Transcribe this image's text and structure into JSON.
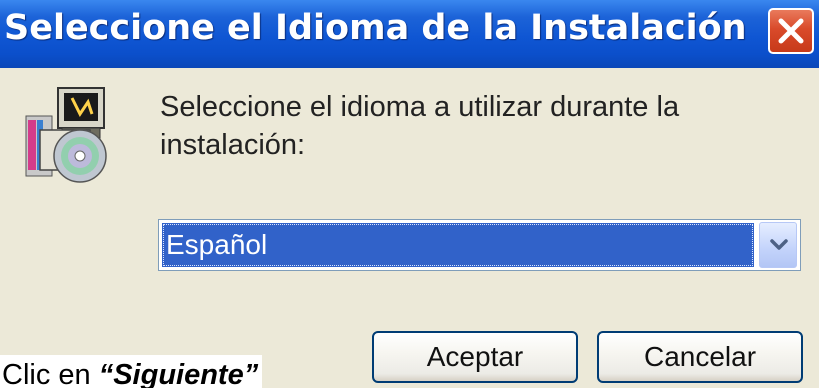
{
  "dialog": {
    "title": "Seleccione el Idioma de la Instalación",
    "prompt": "Seleccione el idioma a utilizar durante la instalación:",
    "language_select": {
      "selected": "Español"
    },
    "buttons": {
      "accept": "Aceptar",
      "cancel": "Cancelar"
    }
  },
  "caption": {
    "prefix": "Clic en ",
    "emphasis": "“Siguiente”"
  },
  "colors": {
    "titlebar": "#0b4fcb",
    "close_button": "#d94a2a",
    "selection": "#3162c9",
    "dialog_background": "#ece9d8"
  },
  "icons": {
    "close": "close-icon",
    "installer": "installer-cd-icon",
    "dropdown": "chevron-down-icon"
  }
}
